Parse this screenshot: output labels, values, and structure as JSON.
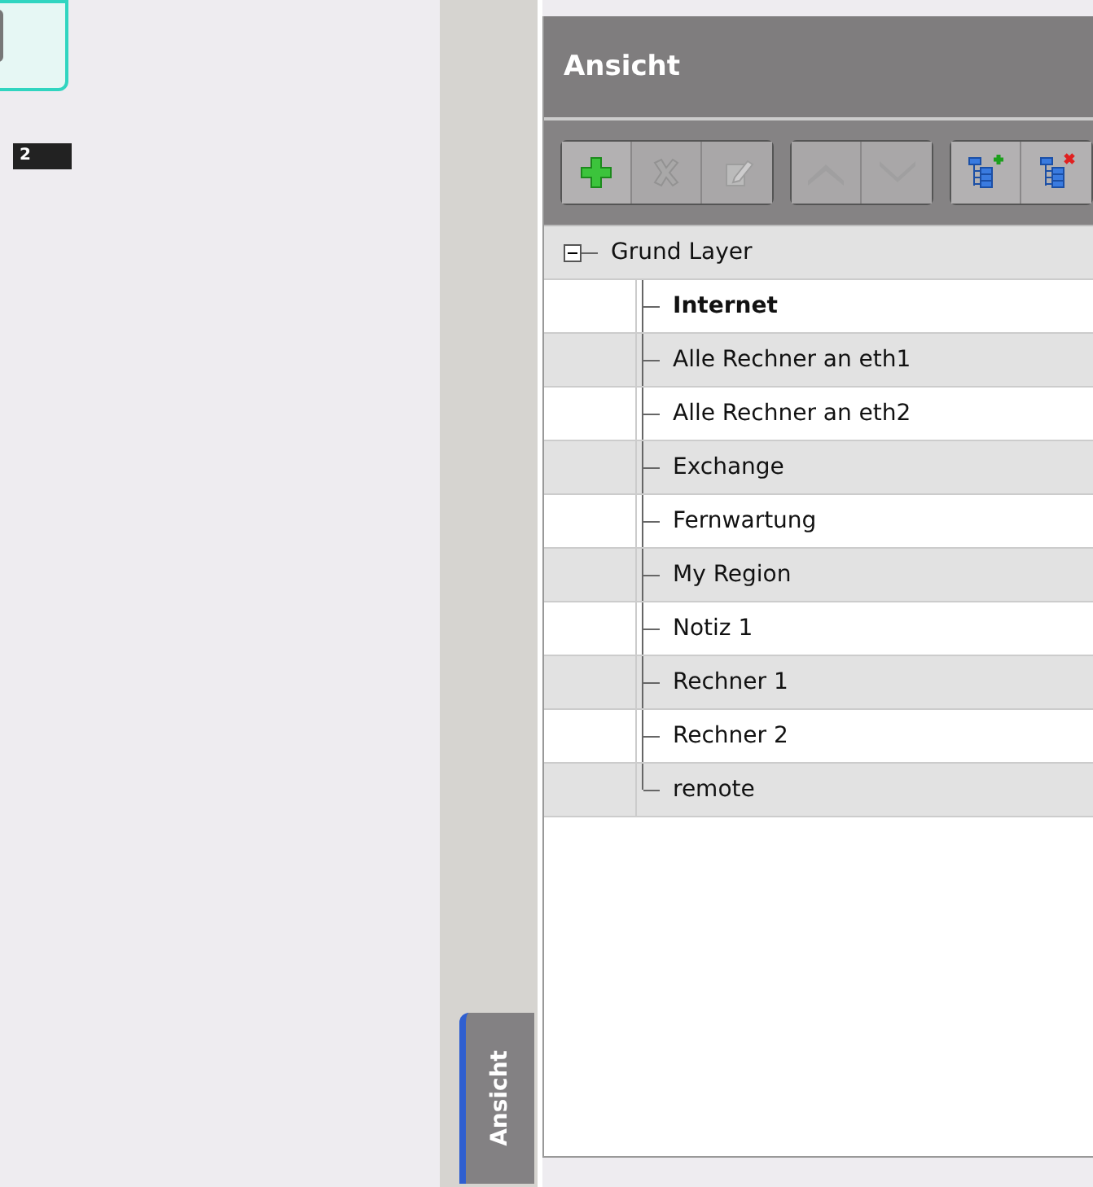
{
  "canvas": {
    "node": {
      "label": "2"
    }
  },
  "side_tab": {
    "label": "Ansicht",
    "selected": true
  },
  "panel": {
    "title": "Ansicht",
    "toolbar": [
      [
        {
          "kind": "add",
          "disabled": false
        },
        {
          "kind": "delete",
          "disabled": true
        },
        {
          "kind": "edit",
          "disabled": true
        }
      ],
      [
        {
          "kind": "up",
          "disabled": true
        },
        {
          "kind": "down",
          "disabled": true
        }
      ],
      [
        {
          "kind": "tree-add",
          "disabled": false
        },
        {
          "kind": "tree-remove",
          "disabled": false
        }
      ]
    ],
    "tree": {
      "label": "Grund Layer",
      "expanded": true,
      "children": [
        {
          "label": "Internet",
          "active": true
        },
        {
          "label": "Alle Rechner an eth1",
          "active": false
        },
        {
          "label": "Alle Rechner an eth2",
          "active": false
        },
        {
          "label": "Exchange",
          "active": false
        },
        {
          "label": "Fernwartung",
          "active": false
        },
        {
          "label": "My Region",
          "active": false
        },
        {
          "label": "Notiz 1",
          "active": false
        },
        {
          "label": "Rechner 1",
          "active": false
        },
        {
          "label": "Rechner 2",
          "active": false
        },
        {
          "label": "remote",
          "active": false
        }
      ]
    }
  }
}
